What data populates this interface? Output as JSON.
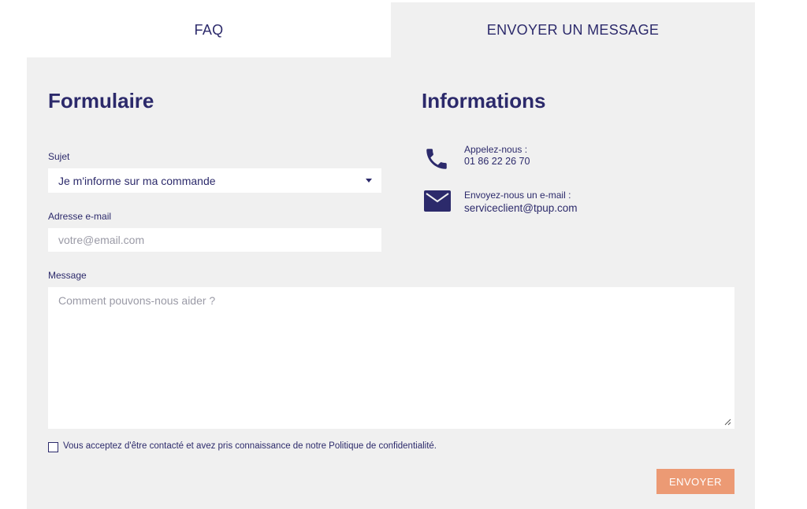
{
  "tabs": {
    "faq_label": "FAQ",
    "message_label": "ENVOYER UN MESSAGE"
  },
  "form": {
    "heading": "Formulaire",
    "subject_label": "Sujet",
    "subject_value": "Je m'informe sur ma commande",
    "email_label": "Adresse e-mail",
    "email_placeholder": "votre@email.com",
    "message_label": "Message",
    "message_placeholder": "Comment pouvons-nous aider ?",
    "consent_text": "Vous acceptez d'être contacté et avez pris connaissance de notre Politique de confidentialité.",
    "submit_label": "ENVOYER"
  },
  "info": {
    "heading": "Informations",
    "phone_label": "Appelez-nous :",
    "phone_value": "01 86 22 26 70",
    "phone_icon": "phone-icon",
    "mail_label": "Envoyez-nous un e-mail :",
    "mail_value": "serviceclient@tpup.com",
    "mail_icon": "envelope-icon"
  },
  "colors": {
    "text": "#2c2a6b",
    "panel_bg": "#f0f0f0",
    "button_bg": "#ec9a74"
  }
}
